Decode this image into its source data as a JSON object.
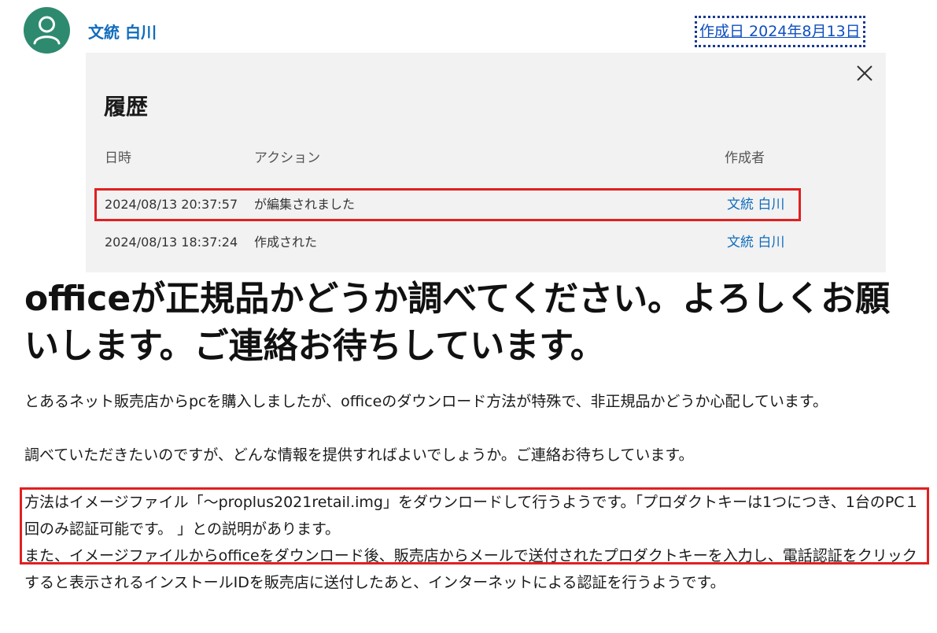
{
  "post": {
    "author": "文統 白川",
    "created": "作成日 2024年8月13日"
  },
  "history": {
    "title": "履歴",
    "columns": {
      "datetime": "日時",
      "action": "アクション",
      "author": "作成者"
    },
    "rows": [
      {
        "datetime": "2024/08/13 20:37:57",
        "action": "が編集されました",
        "author": "文統 白川"
      },
      {
        "datetime": "2024/08/13 18:37:24",
        "action": "作成された",
        "author": "文統 白川"
      }
    ]
  },
  "question": {
    "title": "officeが正規品かどうか調べてください。よろしくお願いします。ご連絡お待ちしています。",
    "para1": "とあるネット販売店からpcを購入しましたが、officeのダウンロード方法が特殊で、非正規品かどうか心配しています。",
    "para2": "調べていただきたいのですが、どんな情報を提供すればよいでしょうか。ご連絡お待ちしています。",
    "para3": "方法はイメージファイル「～proplus2021retail.img」をダウンロードして行うようです。「プロダクトキーは1つにつき、1台のPC１回のみ認証可能です。 」との説明があります。",
    "para4": "また、イメージファイルからofficeをダウンロード後、販売店からメールで送付されたプロダクトキーを入力し、電話認証をクリックすると表示されるインストールIDを販売店に送付したあと、インターネットによる認証を行うようです。"
  },
  "colors": {
    "accent": "#0f6cbd",
    "avatar": "#2e8a6e",
    "highlight": "#e02020",
    "panel": "#f2f2f2"
  }
}
